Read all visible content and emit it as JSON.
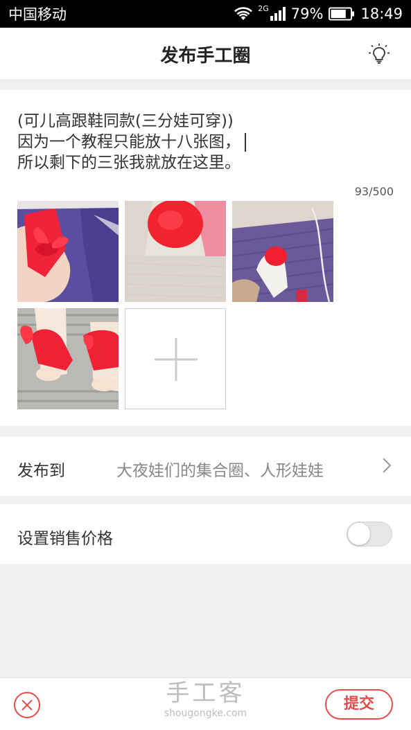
{
  "status_bar": {
    "carrier": "中国移动",
    "network_type": "2G",
    "battery_percent": "79%",
    "battery_level": 0.79,
    "time": "18:49",
    "icons": [
      "wifi-icon",
      "signal-icon",
      "battery-icon"
    ]
  },
  "header": {
    "title": "发布手工圈",
    "right_icon": "lightbulb-icon"
  },
  "post": {
    "lines": [
      "(可儿高跟鞋同款(三分娃可穿))",
      "因为一个教程只能放十八张图，",
      "所以剩下的三张我就放在这里。"
    ],
    "char_count": "93/500",
    "photo_count": 4,
    "add_photo_icon": "plus-icon"
  },
  "publish_to": {
    "label": "发布到",
    "value": "大夜娃们的集合圈、人形娃娃",
    "icon": "chevron-right-icon"
  },
  "price": {
    "label": "设置销售价格",
    "enabled": false
  },
  "bottom_bar": {
    "cancel_icon": "close-icon",
    "watermark_title": "手工客",
    "watermark_url": "shougongke.com",
    "submit_label": "提交"
  },
  "colors": {
    "accent": "#e94a4a",
    "background": "#f1f1f1",
    "card": "#ffffff",
    "secondary_text": "#888888"
  }
}
